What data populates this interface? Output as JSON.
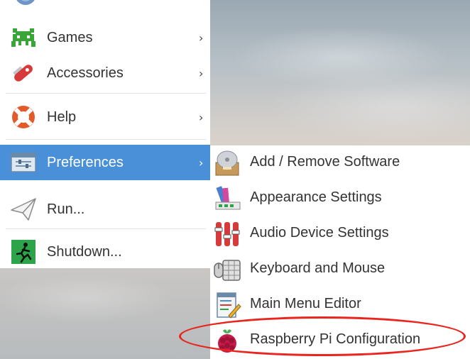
{
  "main_menu": {
    "items": [
      {
        "label": "Games",
        "icon": "games-icon",
        "has_submenu": true
      },
      {
        "label": "Accessories",
        "icon": "accessories-icon",
        "has_submenu": true
      },
      {
        "label": "Help",
        "icon": "help-icon",
        "has_submenu": true
      },
      {
        "label": "Preferences",
        "icon": "preferences-icon",
        "has_submenu": true,
        "selected": true
      },
      {
        "label": "Run...",
        "icon": "run-icon",
        "has_submenu": false
      },
      {
        "label": "Shutdown...",
        "icon": "shutdown-icon",
        "has_submenu": false
      }
    ],
    "arrow_glyph": "›"
  },
  "preferences_submenu": {
    "items": [
      {
        "label": "Add / Remove Software",
        "icon": "add-remove-software-icon"
      },
      {
        "label": "Appearance Settings",
        "icon": "appearance-settings-icon"
      },
      {
        "label": "Audio Device Settings",
        "icon": "audio-device-settings-icon"
      },
      {
        "label": "Keyboard and Mouse",
        "icon": "keyboard-mouse-icon"
      },
      {
        "label": "Main Menu Editor",
        "icon": "main-menu-editor-icon"
      },
      {
        "label": "Raspberry Pi Configuration",
        "icon": "raspberry-pi-icon",
        "highlighted": true
      }
    ]
  },
  "colors": {
    "selection": "#4a90d9",
    "annotation_oval": "#e8261f",
    "menu_bg": "#ffffff",
    "text": "#333333"
  }
}
